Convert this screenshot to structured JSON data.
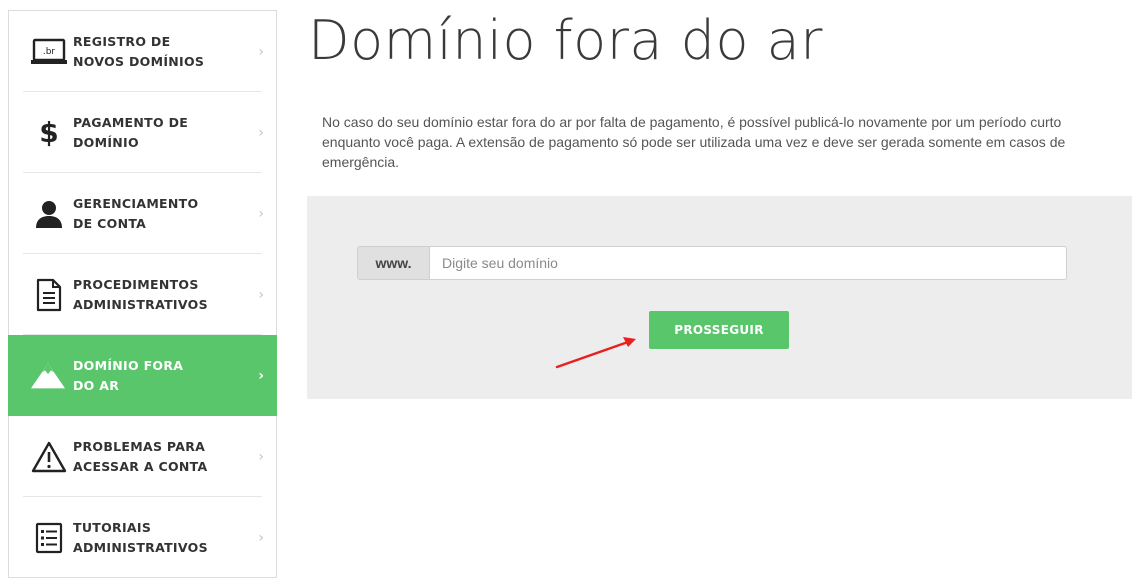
{
  "sidebar": {
    "items": [
      {
        "id": "registro",
        "line1": "REGISTRO DE",
        "line2": "NOVOS DOMÍNIOS",
        "icon": "laptop-br-icon",
        "icon_text": ".br",
        "active": false
      },
      {
        "id": "pagamento",
        "line1": "PAGAMENTO DE",
        "line2": "DOMÍNIO",
        "icon": "dollar-icon",
        "icon_text": "$",
        "active": false
      },
      {
        "id": "gerenciamento",
        "line1": "GERENCIAMENTO",
        "line2": "DE CONTA",
        "icon": "user-icon",
        "active": false
      },
      {
        "id": "procedimentos",
        "line1": "PROCEDIMENTOS",
        "line2": "ADMINISTRATIVOS",
        "icon": "document-icon",
        "active": false
      },
      {
        "id": "dominio-fora",
        "line1": "DOMÍNIO FORA",
        "line2": "DO AR",
        "icon": "mountain-icon",
        "active": true
      },
      {
        "id": "problemas",
        "line1": "PROBLEMAS PARA",
        "line2": "ACESSAR A CONTA",
        "icon": "warning-icon",
        "active": false
      },
      {
        "id": "tutoriais",
        "line1": "TUTORIAIS",
        "line2": "ADMINISTRATIVOS",
        "icon": "list-icon",
        "active": false
      }
    ],
    "chevron": "›"
  },
  "main": {
    "title": "Domínio fora do ar",
    "description": "No caso do seu domínio estar fora do ar por falta de pagamento, é possível publicá-lo novamente por um período curto enquanto você paga. A extensão de pagamento só pode ser utilizada uma vez e deve ser gerada somente em casos de emergência.",
    "form": {
      "prefix": "www.",
      "input_value": "",
      "input_placeholder": "Digite seu domínio",
      "submit_label": "PROSSEGUIR"
    }
  },
  "colors": {
    "accent": "#5ac66c",
    "panel_bg": "#ededed",
    "annotation_arrow": "#e8201e"
  }
}
